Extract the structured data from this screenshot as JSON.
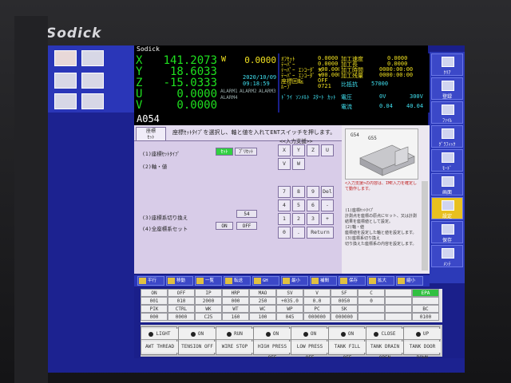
{
  "brand": "Sodick",
  "header": {
    "title": "Sodick"
  },
  "coords": [
    {
      "axis": "X",
      "value": "141.2073"
    },
    {
      "axis": "Y",
      "value": "18.6033"
    },
    {
      "axis": "Z",
      "value": "-15.0333"
    },
    {
      "axis": "U",
      "value": "0.0000"
    },
    {
      "axis": "V",
      "value": "0.0000"
    }
  ],
  "w_axis": {
    "label": "W",
    "value": "0.0000"
  },
  "datetime": {
    "date": "2020/10/09",
    "time": "09:18:59"
  },
  "alarms": [
    "ALARM1",
    "ALARM2",
    "ALARM3",
    "ALARM4"
  ],
  "program": "A054",
  "machine_info": {
    "rows": [
      "ｵﾌｾｯﾄ",
      "ﾃｰﾊﾟｰ",
      "ﾃｰﾊﾟｰ ｴﾝｺｰﾀﾞ X",
      "ﾃｰﾊﾟｰ ｴﾝｺｰﾀﾞ Y",
      "座標回転",
      "ﾙｰﾌﾟ"
    ],
    "values": [
      "0.0000",
      "0.0000",
      "+00.00000",
      "+00.00000",
      "OFF",
      "0721"
    ],
    "right": [
      "加工速度",
      "加工長",
      "加工時間",
      "加工残量"
    ],
    "right_values": [
      "0.0000",
      "0.0000",
      "0000:00:00",
      "0000:00:00"
    ],
    "counter": {
      "label": "比抵抗",
      "value": "57000"
    },
    "r2": [
      "電圧",
      "0V",
      "300V"
    ],
    "r3": [
      "電流",
      "0.04",
      "40.04"
    ]
  },
  "tab": "座標\nｾｯﾄ",
  "instruction": "座標ｾｯﾄﾀｲﾌﾟを選択し、軸と値を入れてENTスイッチを押します。",
  "fields": {
    "f1": "(1)座標ｾｯﾄﾀｲﾌﾟ",
    "f2": "(2)軸・値",
    "f3": "(3)座標系切り換え",
    "f4": "(4)全座標系セット",
    "f1_opt1": "ｾｯﾄ",
    "f1_opt2": "ﾌﾟﾘｾｯﾄ",
    "f3_val": "54",
    "f4_on": "ON",
    "f4_off": "OFF"
  },
  "keypad": {
    "label": "<<入力支援>>",
    "keys": [
      "X",
      "Y",
      "Z",
      "U",
      "V",
      "W",
      "7",
      "8",
      "9",
      "Del",
      "4",
      "5",
      "6",
      "-",
      "1",
      "2",
      "3",
      "+",
      "0",
      ".",
      "Return"
    ]
  },
  "help": {
    "image_label1": "G54",
    "image_label2": "G55",
    "text_red": "<入力支援>の内容は、IME入力を確定して動作します。",
    "text": "(1)座標ｾｯﾄﾀｲﾌﾟ\n計測点を座標の原点にセット、又は計測結果を座標値として設定。\n(2)軸・値\n座標値を設定した軸と値を設定します。\n(3)座標系切り換え\n切り換えた座標系の内容を設定します。"
  },
  "sidebar_right": [
    "ｸﾘｱ",
    "登録",
    "ﾌｧｲﾙ",
    "ｸﾞﾗﾌｨｯｸ",
    "ﾓｰﾄﾞ",
    "画面",
    "設定",
    "保存",
    "ﾒﾝﾃ"
  ],
  "toolbar": [
    "平行",
    "移動",
    "一覧",
    "転送",
    "GH",
    "最小",
    "補間",
    "保存",
    "拡大",
    "縮小"
  ],
  "codes": {
    "row1": [
      "ON",
      "OFF",
      "IP",
      "HRP",
      "MAO",
      "SV",
      "V",
      "SF",
      "C",
      "",
      "EPA"
    ],
    "row1v": [
      "001",
      "010",
      "2000",
      "000",
      "250",
      "+035.0",
      "0.0",
      "0050",
      "0",
      "",
      ""
    ],
    "row2": [
      "PIK",
      "CTRL",
      "WK",
      "WT",
      "WC",
      "WP",
      "PC",
      "SK",
      "",
      "",
      "BC"
    ],
    "row2v": [
      "000",
      "0000",
      "C25",
      "160",
      "100",
      "045",
      "000000",
      "000000",
      "",
      "",
      "0100"
    ],
    "accent": "#30c040"
  },
  "status_buttons": [
    {
      "top": "LIGHT",
      "bottom": "AWT THREAD"
    },
    {
      "top": "ON",
      "bottom": "TENSION OFF"
    },
    {
      "top": "RUN",
      "bottom": "WIRE STOP"
    },
    {
      "top": "ON",
      "bottom": "HIGH PRESS OFF"
    },
    {
      "top": "ON",
      "bottom": "LOW PRESS OFF"
    },
    {
      "top": "ON",
      "bottom": "TANK FILL OFF"
    },
    {
      "top": "CLOSE",
      "bottom": "TANK DRAIN OPEN"
    },
    {
      "top": "UP",
      "bottom": "TANK DOOR DOWN"
    }
  ]
}
